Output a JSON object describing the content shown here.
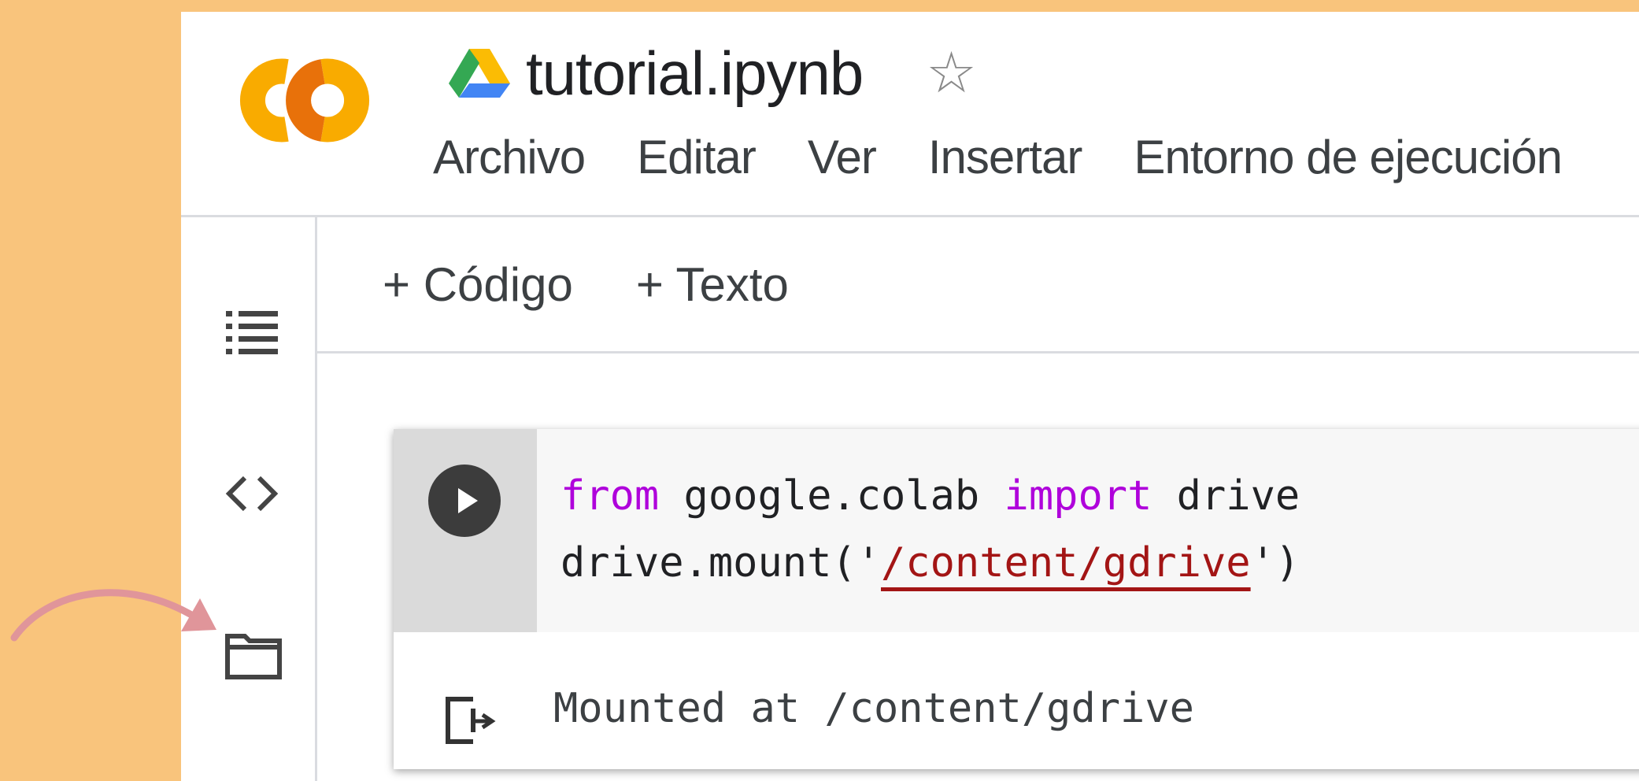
{
  "app": {
    "logo_icon": "colab-logo",
    "drive_icon": "google-drive-icon",
    "title": "tutorial.ipynb",
    "star_icon": "star-outline-icon",
    "star_glyph": "☆"
  },
  "menu": {
    "items": [
      "Archivo",
      "Editar",
      "Ver",
      "Insertar",
      "Entorno de ejecución"
    ]
  },
  "toolbar": {
    "add_code": "+ Código",
    "add_text": "+ Texto"
  },
  "sidebar": {
    "icons": [
      "table-of-contents-icon",
      "code-snippets-icon",
      "files-folder-icon"
    ]
  },
  "cell": {
    "line1": {
      "kw1": "from",
      "mod": " google.colab ",
      "kw2": "import",
      "name": " drive"
    },
    "line2": {
      "pre": "drive.mount('",
      "str": "/content/gdrive",
      "post": "')"
    },
    "output": "Mounted at /content/gdrive"
  },
  "colors": {
    "background": "#f9c47c",
    "keyword": "#af00db",
    "string": "#a31515",
    "arrow": "#e0959a"
  }
}
